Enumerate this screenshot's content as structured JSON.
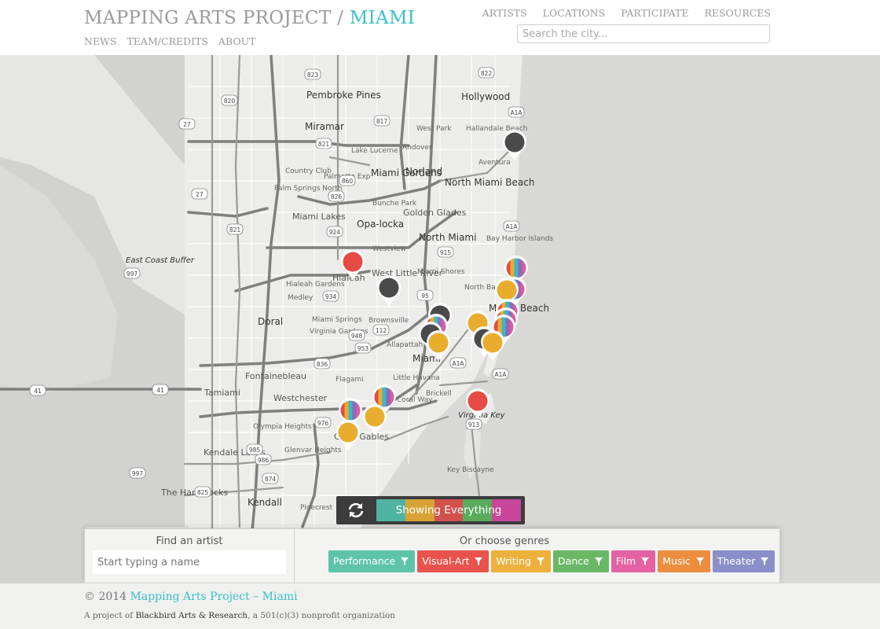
{
  "header": {
    "brand": "MAPPING ARTS PROJECT / ",
    "city": "MIAMI",
    "subnav": [
      "NEWS",
      "TEAM/CREDITS",
      "ABOUT"
    ],
    "nav": [
      "ARTISTS",
      "LOCATIONS",
      "PARTICIPATE",
      "RESOURCES"
    ],
    "search_placeholder": "Search the city..."
  },
  "map": {
    "places": [
      "Pembroke Pines",
      "Hollywood",
      "Miramar",
      "West Park",
      "Hallandale Beach",
      "Lake Lucerne",
      "Andover",
      "Aventura",
      "Country Club",
      "Miami Gardens",
      "Norland",
      "North Miami Beach",
      "Palm Springs North",
      "Palmetto Exp",
      "Bunche Park",
      "Miami Lakes",
      "Golden Glades",
      "Opa-locka",
      "North Miami",
      "Bay Harbor Islands",
      "Westview",
      "East Coast Buffer",
      "Hialeah Gardens",
      "Hialeah",
      "West Little River",
      "Miami Shores",
      "North Bay Village",
      "Medley",
      "Doral",
      "Miami Springs",
      "Brownsville",
      "Virginia Gardens",
      "Miami Beach",
      "Allapattah",
      "Miami",
      "Fontainebleau",
      "Flagami",
      "Little Havana",
      "Tamiami",
      "Westchester",
      "Coral Way",
      "Brickell",
      "Virginia Key",
      "Olympia Heights",
      "Coral Gables",
      "Kendale Lakes",
      "Glenvar Heights",
      "Key Biscayne",
      "The Hammocks",
      "Kendall",
      "Pinecrest"
    ],
    "shields": [
      "823",
      "820",
      "27",
      "817",
      "822",
      "A1A",
      "821",
      "27",
      "860",
      "826",
      "924",
      "821",
      "915",
      "A1A",
      "997",
      "934",
      "95",
      "112",
      "948",
      "953",
      "A1A",
      "836",
      "A1A",
      "41",
      "41",
      "976",
      "913",
      "985",
      "986",
      "997",
      "874",
      "825"
    ],
    "pin_colors": {
      "red": "#e84b45",
      "gray": "#4a4a4a",
      "gold": "#e9ad2e",
      "rainbow": [
        "#e84b45",
        "#e9ad2e",
        "#6dbb5a",
        "#3bb6c9",
        "#8b6bb7",
        "#e05aa0"
      ]
    }
  },
  "show_bar": {
    "label": "Showing Everything",
    "stripe_colors": [
      "#4eb3a0",
      "#d9a235",
      "#d2514c",
      "#5aab5e",
      "#c8469a"
    ]
  },
  "panel": {
    "artist_label": "Find an artist",
    "artist_placeholder": "Start typing a name",
    "genre_label": "Or choose genres",
    "genres": [
      {
        "name": "Performance",
        "color": "#5ec4a8"
      },
      {
        "name": "Visual-Art",
        "color": "#e8534d"
      },
      {
        "name": "Writing",
        "color": "#ebb13c"
      },
      {
        "name": "Dance",
        "color": "#6ab865"
      },
      {
        "name": "Film",
        "color": "#e462a3"
      },
      {
        "name": "Music",
        "color": "#ed8d3e"
      },
      {
        "name": "Theater",
        "color": "#8a8fc9"
      }
    ]
  },
  "footer": {
    "copyright": "© 2014 ",
    "project_name": "Mapping Arts Project – Miami",
    "project_prefix": "A project of ",
    "org": "Blackbird Arts & Research",
    "project_suffix": ", a 501(c)(3) nonprofit organization"
  }
}
